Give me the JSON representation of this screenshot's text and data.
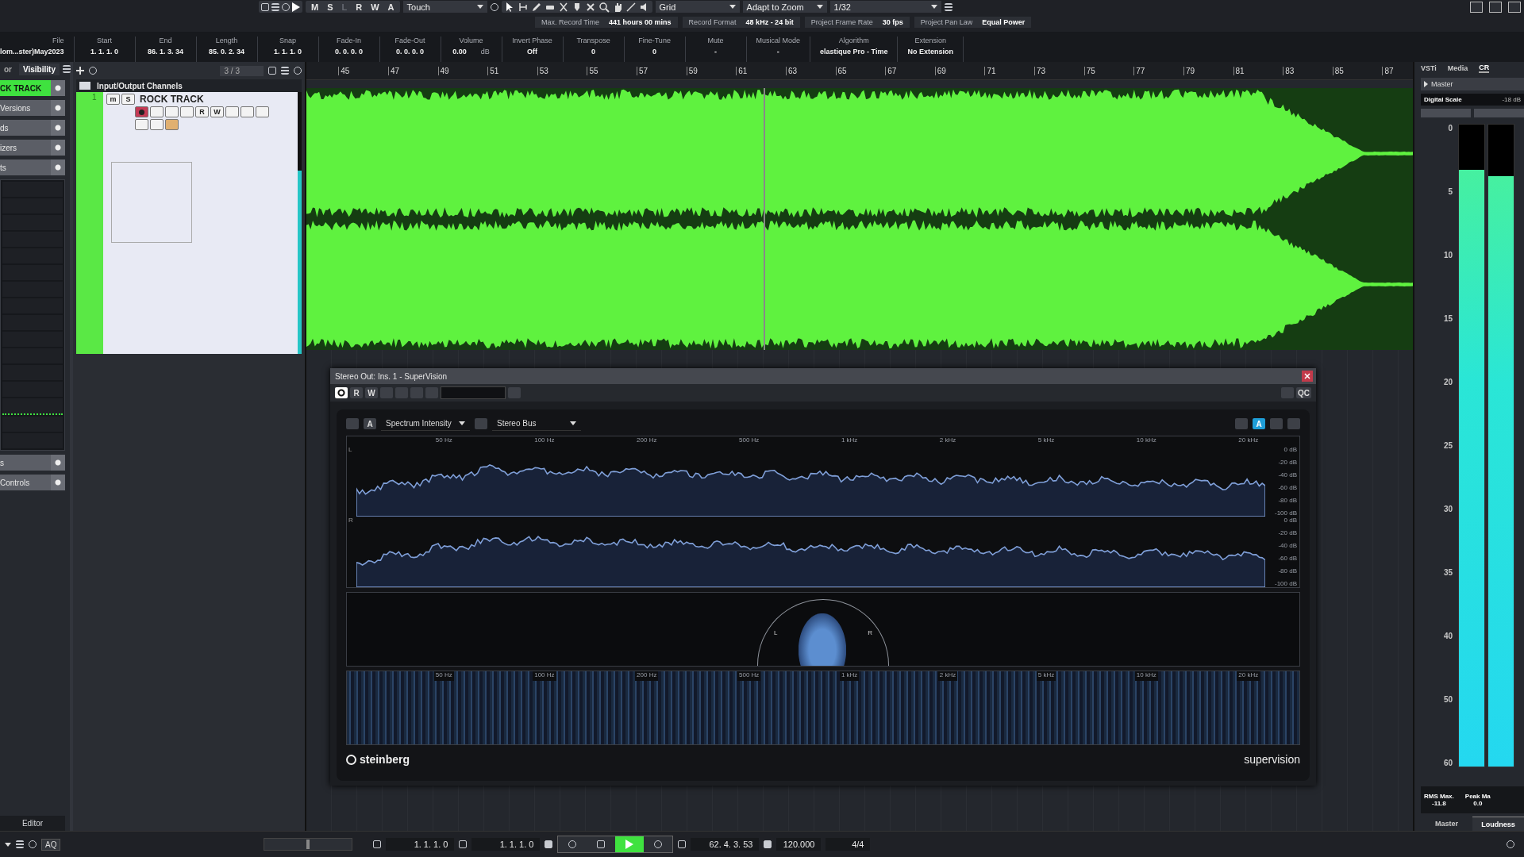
{
  "toolbar": {
    "mode_buttons": [
      {
        "label": "M",
        "disabled": false
      },
      {
        "label": "S",
        "disabled": false
      },
      {
        "label": "L",
        "disabled": true
      },
      {
        "label": "R",
        "disabled": false
      },
      {
        "label": "W",
        "disabled": false
      },
      {
        "label": "A",
        "disabled": false
      }
    ],
    "automation_mode": "Touch",
    "snap_type": "Grid",
    "zoom_mode": "Adapt to Zoom",
    "quantize": "1/32"
  },
  "status_line": [
    {
      "label": "Max. Record Time",
      "value": "441 hours 00 mins"
    },
    {
      "label": "Record Format",
      "value": "48 kHz - 24 bit"
    },
    {
      "label": "Project Frame Rate",
      "value": "30 fps"
    },
    {
      "label": "Project Pan Law",
      "value": "Equal Power"
    }
  ],
  "info_line": [
    {
      "label": "File",
      "value": "lom...ster)May2023"
    },
    {
      "label": "Start",
      "value": "1. 1. 1. 0"
    },
    {
      "label": "End",
      "value": "86. 1. 3. 34"
    },
    {
      "label": "Length",
      "value": "85. 0. 2. 34"
    },
    {
      "label": "Snap",
      "value": "1. 1. 1. 0"
    },
    {
      "label": "Fade-In",
      "value": "0. 0. 0. 0"
    },
    {
      "label": "Fade-Out",
      "value": "0. 0. 0. 0"
    },
    {
      "label": "Volume",
      "value": "0.00",
      "unit": "dB"
    },
    {
      "label": "Invert Phase",
      "value": "Off"
    },
    {
      "label": "Transpose",
      "value": "0"
    },
    {
      "label": "Fine-Tune",
      "value": "0"
    },
    {
      "label": "Mute",
      "value": "-"
    },
    {
      "label": "Musical Mode",
      "value": "-"
    },
    {
      "label": "Algorithm",
      "value": "elastique Pro - Time"
    },
    {
      "label": "Extension",
      "value": "No Extension"
    }
  ],
  "inspector": {
    "tabs": [
      {
        "label": "or",
        "selected": false
      },
      {
        "label": "Visibility",
        "selected": true
      }
    ],
    "track_name": "CK TRACK",
    "sections_top": [
      {
        "label": "Versions"
      },
      {
        "label": "ds"
      },
      {
        "label": "izers"
      },
      {
        "label": "ts"
      }
    ],
    "sections_bottom": [
      {
        "label": "s"
      },
      {
        "label": "Controls"
      }
    ],
    "footer": "Editor"
  },
  "track_list": {
    "counter": "3 / 3",
    "folder": "Input/Output Channels",
    "track": {
      "number": "1",
      "name": "ROCK TRACK",
      "mute_label": "m",
      "solo_label": "S",
      "read_label": "R",
      "write_label": "W",
      "record_enabled": true
    }
  },
  "ruler": [
    "45",
    "47",
    "49",
    "51",
    "53",
    "55",
    "57",
    "59",
    "61",
    "63",
    "65",
    "67",
    "69",
    "71",
    "73",
    "75",
    "77",
    "79",
    "81",
    "83",
    "85",
    "87"
  ],
  "plugin": {
    "title": "Stereo Out: Ins. 1 - SuperVision",
    "read_label": "R",
    "write_label": "W",
    "qc_label": "QC",
    "letter_button": "A",
    "module": "Spectrum Intensity",
    "bus": "Stereo Bus",
    "active_letter": "A",
    "spectrum_freq_labels": [
      "50 Hz",
      "100 Hz",
      "200 Hz",
      "500 Hz",
      "1 kHz",
      "2 kHz",
      "5 kHz",
      "10 kHz",
      "20 kHz"
    ],
    "channels": [
      {
        "label": "L",
        "db_labels": [
          "0 dB",
          "-20 dB",
          "-40 dB",
          "-60 dB",
          "-80 dB",
          "-100 dB"
        ]
      },
      {
        "label": "R",
        "db_labels": [
          "0 dB",
          "-20 dB",
          "-40 dB",
          "-60 dB",
          "-80 dB",
          "-100 dB"
        ]
      }
    ],
    "spectrogram_freq_labels": [
      "50 Hz",
      "100 Hz",
      "200 Hz",
      "500 Hz",
      "1 kHz",
      "2 kHz",
      "5 kHz",
      "10 kHz",
      "20 kHz"
    ],
    "correlation_labels": [
      "L",
      "R"
    ],
    "brand": "steinberg",
    "product": "supervision"
  },
  "right_zone": {
    "tabs": [
      {
        "label": "VSTi",
        "selected": false
      },
      {
        "label": "Media",
        "selected": false
      },
      {
        "label": "CR",
        "selected": true
      }
    ],
    "preset": "Master",
    "scale_label": "Digital Scale",
    "scale_value": "-18 dB",
    "scale": [
      "0",
      "5",
      "10",
      "15",
      "20",
      "25",
      "30",
      "35",
      "40",
      "50",
      "60"
    ],
    "meters": [
      {
        "level": 0.93
      },
      {
        "level": 0.92
      }
    ],
    "readouts": [
      {
        "label": "RMS Max.",
        "value": "-11.8"
      },
      {
        "label": "Peak Ma",
        "value": "0.0"
      }
    ],
    "bottom_tabs": [
      {
        "label": "Master",
        "selected": false
      },
      {
        "label": "Loudness",
        "selected": true
      }
    ]
  },
  "transport": {
    "shuttle": {
      "level": 0.5
    },
    "aq": "AQ",
    "left_locator": "1. 1. 1. 0",
    "right_locator": "1. 1. 1. 0",
    "playing": true,
    "position": "62. 4. 3. 53",
    "tempo": "120.000",
    "signature": "4/4"
  }
}
